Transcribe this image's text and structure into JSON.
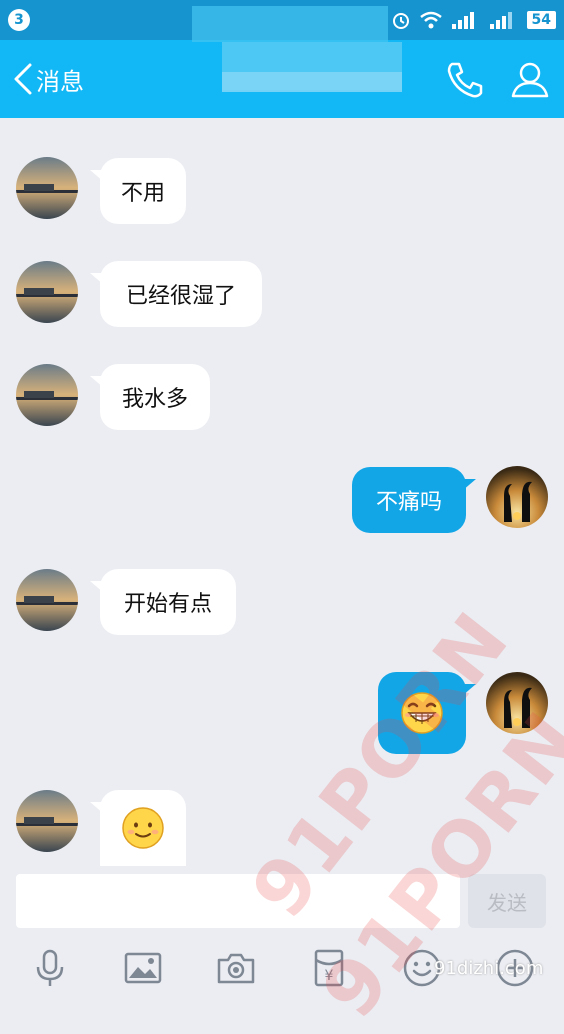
{
  "status_bar": {
    "notification_count": "3",
    "battery": "54"
  },
  "header": {
    "back_label": "消息",
    "contact_name": ""
  },
  "messages": [
    {
      "side": "in",
      "text": "不用"
    },
    {
      "side": "in",
      "text": "已经很湿了"
    },
    {
      "side": "in",
      "text": "我水多"
    },
    {
      "side": "out",
      "text": "不痛吗"
    },
    {
      "side": "in",
      "text": "开始有点"
    },
    {
      "side": "out",
      "emoji": "grin-emoji"
    },
    {
      "side": "in",
      "emoji": "smile-emoji"
    }
  ],
  "input": {
    "value": "",
    "placeholder": ""
  },
  "send_label": "发送",
  "toolbar": [
    "mic-icon",
    "image-icon",
    "camera-icon",
    "red-packet-icon",
    "emoji-icon",
    "plus-icon"
  ],
  "red_packet_symbol": "¥",
  "watermark": "91PORN",
  "site_mark": "91dizhi.com",
  "colors": {
    "header": "#12b7f5",
    "status_bar": "#1594cf",
    "outgoing_bubble": "#13a6e7",
    "background": "#ebedf2"
  }
}
